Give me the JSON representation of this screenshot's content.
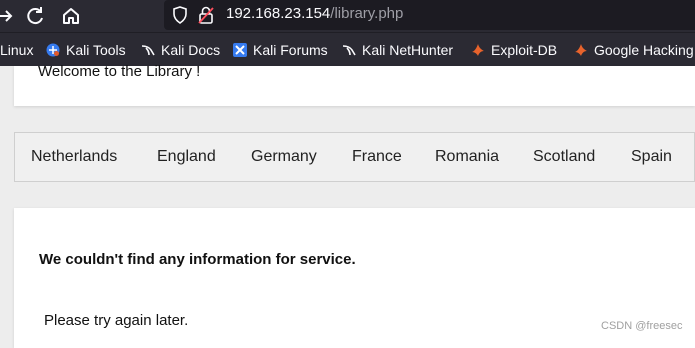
{
  "browser": {
    "url_host": "192.168.23.154",
    "url_path": "/library.php",
    "bookmarks": [
      {
        "label": "Linux",
        "icon": "kali-icon"
      },
      {
        "label": "Kali Tools",
        "icon": "kali-tools-icon"
      },
      {
        "label": "Kali Docs",
        "icon": "kali-dragon-icon"
      },
      {
        "label": "Kali Forums",
        "icon": "kali-forums-icon"
      },
      {
        "label": "Kali NetHunter",
        "icon": "kali-dragon-icon"
      },
      {
        "label": "Exploit-DB",
        "icon": "exploit-db-icon"
      },
      {
        "label": "Google Hacking",
        "icon": "exploit-db-icon"
      }
    ]
  },
  "page": {
    "welcome": "Welcome to the Library !",
    "nav_items": [
      "Netherlands",
      "England",
      "Germany",
      "France",
      "Romania",
      "Scotland",
      "Spain"
    ],
    "error_message": "We couldn't find any information for service.",
    "retry_message": "Please try again later."
  },
  "watermark": "CSDN @freesec",
  "colors": {
    "toolbar": "#2b2a33",
    "urlbar": "#1c1b22",
    "page_bg": "#ededed",
    "nav_bg": "#f0f0f0"
  }
}
